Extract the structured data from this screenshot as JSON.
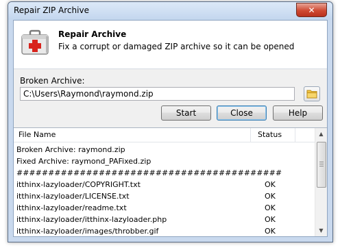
{
  "window": {
    "title": "Repair ZIP Archive",
    "close_glyph": "✕"
  },
  "header": {
    "title": "Repair Archive",
    "subtitle": "Fix a corrupt or damaged ZIP archive so it can be opened",
    "icon": "first-aid-kit-icon"
  },
  "form": {
    "label": "Broken Archive:",
    "path_value": "C:\\Users\\Raymond\\raymond.zip",
    "browse_icon": "folder-icon"
  },
  "buttons": {
    "start": "Start",
    "close": "Close",
    "help": "Help"
  },
  "list": {
    "columns": {
      "file": "File Name",
      "status": "Status"
    },
    "rows": [
      {
        "name": "Broken Archive: raymond.zip",
        "status": ""
      },
      {
        "name": "Fixed Archive: raymond_PAFixed.zip",
        "status": ""
      },
      {
        "name": "##########################################",
        "status": ""
      },
      {
        "name": "itthinx-lazyloader/COPYRIGHT.txt",
        "status": "OK"
      },
      {
        "name": "itthinx-lazyloader/LICENSE.txt",
        "status": "OK"
      },
      {
        "name": "itthinx-lazyloader/readme.txt",
        "status": "OK"
      },
      {
        "name": "itthinx-lazyloader/itthinx-lazyloader.php",
        "status": "OK"
      },
      {
        "name": "itthinx-lazyloader/images/throbber.gif",
        "status": "OK"
      }
    ]
  },
  "colors": {
    "accent": "#3c7fb1",
    "title_bar": "#c9d9ee",
    "close_button": "#cf4a33"
  }
}
